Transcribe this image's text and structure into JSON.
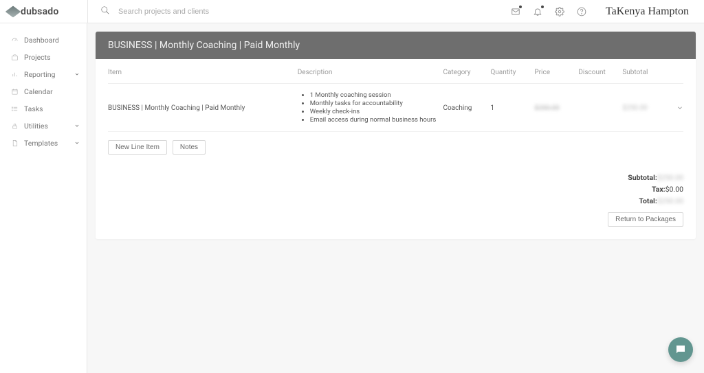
{
  "brand": "dubsado",
  "search": {
    "placeholder": "Search projects and clients"
  },
  "signature": "TaKenya Hampton",
  "sidebar": {
    "items": [
      {
        "label": "Dashboard",
        "expandable": false
      },
      {
        "label": "Projects",
        "expandable": false
      },
      {
        "label": "Reporting",
        "expandable": true
      },
      {
        "label": "Calendar",
        "expandable": false
      },
      {
        "label": "Tasks",
        "expandable": false
      },
      {
        "label": "Utilities",
        "expandable": true
      },
      {
        "label": "Templates",
        "expandable": true
      }
    ]
  },
  "page": {
    "title": "BUSINESS | Monthly Coaching | Paid Monthly",
    "columns": {
      "item": "Item",
      "description": "Description",
      "category": "Category",
      "quantity": "Quantity",
      "price": "Price",
      "discount": "Discount",
      "subtotal": "Subtotal"
    },
    "row": {
      "item": "BUSINESS | Monthly Coaching | Paid Monthly",
      "desc": [
        "1 Monthly coaching session",
        "Monthly tasks for accountability",
        "Weekly check-ins",
        "Email access during normal business hours"
      ],
      "category": "Coaching",
      "quantity": "1",
      "price": "$250.00",
      "discount": "",
      "subtotal": "$250.00"
    },
    "buttons": {
      "new_line_item": "New Line Item",
      "notes": "Notes",
      "return": "Return to Packages"
    },
    "totals": {
      "subtotal_label": "Subtotal:",
      "subtotal_value": "$250.00",
      "tax_label": "Tax:",
      "tax_value": "$0.00",
      "total_label": "Total:",
      "total_value": "$250.00"
    }
  }
}
